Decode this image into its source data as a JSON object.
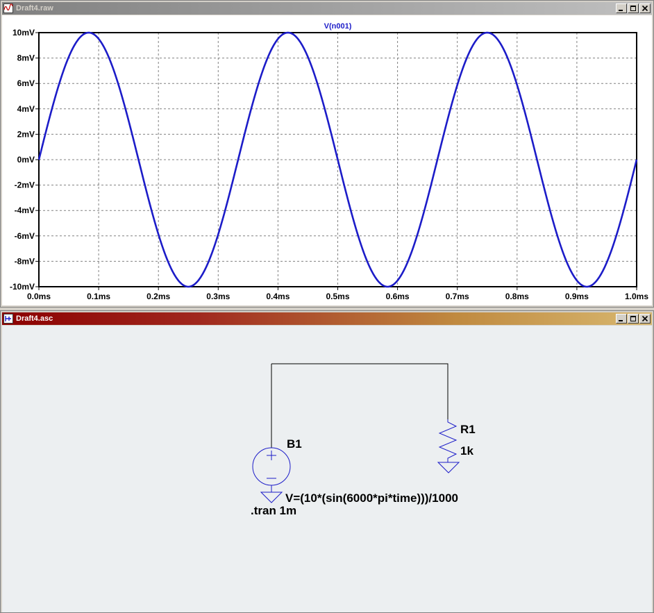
{
  "waveform_window": {
    "title": "Draft4.raw",
    "icon": "waveform-icon"
  },
  "schematic_window": {
    "title": "Draft4.asc",
    "icon": "schematic-icon"
  },
  "window_buttons": [
    "minimize",
    "restore",
    "close"
  ],
  "schematic": {
    "source_name": "B1",
    "source_value": "V=(10*(sin(6000*pi*time)))/1000",
    "resistor_name": "R1",
    "resistor_value": "1k",
    "directive": ".tran 1m"
  },
  "colors": {
    "trace": "#1c1cc8",
    "component": "#1c1cc8",
    "wire": "#000000",
    "grid": "#808080",
    "axis_text": "#000000"
  },
  "chart_data": {
    "type": "line",
    "title": "V(n001)",
    "xlabel": "",
    "ylabel": "",
    "xlim": [
      0,
      1.0
    ],
    "ylim": [
      -10,
      10
    ],
    "x_unit": "ms",
    "y_unit": "mV",
    "x_ticks": [
      "0.0ms",
      "0.1ms",
      "0.2ms",
      "0.3ms",
      "0.4ms",
      "0.5ms",
      "0.6ms",
      "0.7ms",
      "0.8ms",
      "0.9ms",
      "1.0ms"
    ],
    "y_ticks": [
      "10mV",
      "8mV",
      "6mV",
      "4mV",
      "2mV",
      "0mV",
      "-2mV",
      "-4mV",
      "-6mV",
      "-8mV",
      "-10mV"
    ],
    "grid": true,
    "series": [
      {
        "name": "V(n001)",
        "function": "10*sin(6000*pi*t)",
        "amplitude": 10,
        "frequency_hz": 3000,
        "x": [
          0,
          0.0833,
          0.1667,
          0.25,
          0.3333,
          0.4167,
          0.5,
          0.5833,
          0.6667,
          0.75,
          0.8333,
          0.9167,
          1.0
        ],
        "values": [
          0,
          10,
          0,
          -10,
          0,
          10,
          0,
          -10,
          0,
          10,
          0,
          -10,
          0
        ]
      }
    ]
  }
}
